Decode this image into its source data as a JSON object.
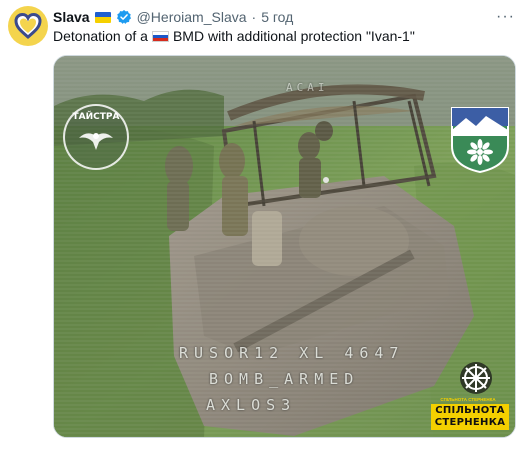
{
  "tweet": {
    "author_name": "Slava",
    "author_handle": "@Heroiam_Slava",
    "separator": "·",
    "timestamp": "5 год",
    "text_before": "Detonation of a",
    "text_after": "BMD with additional protection \"Ivan-1\"",
    "flag_after_name": "ukraine-flag-icon",
    "flag_in_text": "russia-flag-icon",
    "more_label": "···"
  },
  "media": {
    "osd_top": "ACAI",
    "osd_line_1": "RUSOR12 XL 4647",
    "osd_line_2": "BOMB_ARMED",
    "osd_line_3": "AXLOS3",
    "logo_left_text": "ТАЙСТРА",
    "community_line_1": "СПІЛЬНОТА",
    "community_line_2": "СТЕРНЕНКА",
    "community_small": "СПІЛЬНОТА СТЕРНЕНКА"
  },
  "colors": {
    "avatar_bg": "#f4d44d",
    "verified": "#1d9bf0",
    "secondary_text": "#536471",
    "community_yellow": "#f4d000"
  }
}
